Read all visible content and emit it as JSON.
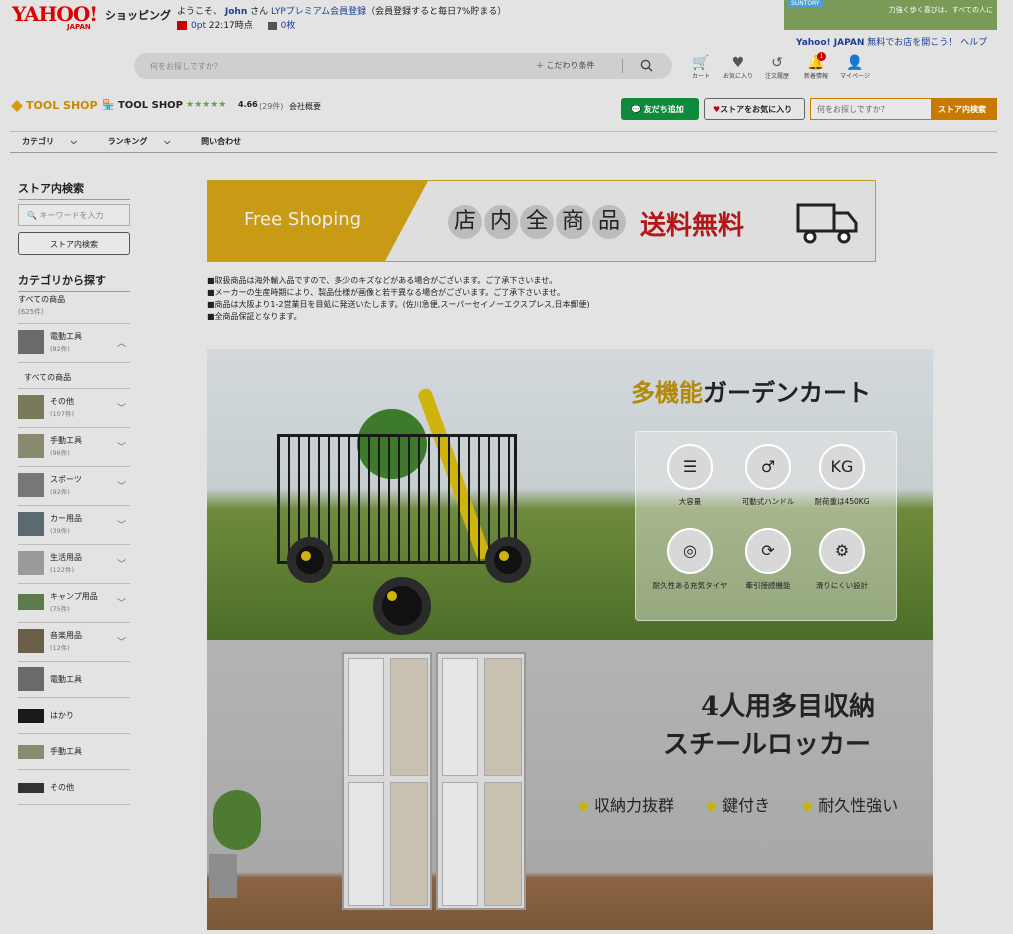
{
  "header": {
    "logo": "YAHOO!",
    "logo_sub": "JAPAN",
    "shopping": "ショッピング",
    "welcome_pre": "ようこそ、",
    "user": "John",
    "welcome_san": "さん",
    "lyp_link": "LYPプレミアム会員登録",
    "lyp_note": "（会員登録すると毎日7%貯まる）",
    "points": "0pt",
    "points_time": "22:17時点",
    "coupons": "0枚",
    "ad_brand": "SUNTORY",
    "ad_text": "力強く歩く喜びは、すべての人に",
    "links": [
      "Yahoo! JAPAN",
      "無料でお店を開こう！",
      "ヘルプ"
    ]
  },
  "search": {
    "placeholder": "何をお探しですか？",
    "conditions": "こだわり条件"
  },
  "icons": [
    {
      "label": "カート",
      "icon": "cart-icon"
    },
    {
      "label": "お気に入り",
      "icon": "heart-icon"
    },
    {
      "label": "注文履歴",
      "icon": "history-icon"
    },
    {
      "label": "新着情報",
      "icon": "bell-icon",
      "badge": "1"
    },
    {
      "label": "マイページ",
      "icon": "user-icon"
    }
  ],
  "store": {
    "logo": "TOOL SHOP",
    "name": "TOOL SHOP",
    "stars": "★★★★★",
    "rating": "4.66",
    "count": "(29件)",
    "about": "会社概要",
    "line_btn": "友だち追加",
    "fav_btn": "ストアをお気に入り",
    "search_placeholder": "何をお探しですか？",
    "search_btn": "ストア内検索"
  },
  "nav": [
    "カテゴリ",
    "ランキング",
    "問い合わせ"
  ],
  "sidebar": {
    "search_title": "ストア内検索",
    "keyword_placeholder": "キーワードを入力",
    "search_btn": "ストア内検索",
    "cat_title": "カテゴリから探す",
    "all": "すべての商品",
    "all_count": "(625件)",
    "categories": [
      {
        "name": "電動工具",
        "count": "(82件)"
      },
      {
        "name": "すべての商品"
      },
      {
        "name": "その他",
        "count": "(107件)"
      },
      {
        "name": "手動工具",
        "count": "(96件)"
      },
      {
        "name": "スポーツ",
        "count": "(92件)"
      },
      {
        "name": "カー用品",
        "count": "(39件)"
      },
      {
        "name": "生活用品",
        "count": "(122件)"
      },
      {
        "name": "キャンプ用品",
        "count": "(75件)"
      },
      {
        "name": "音楽用品",
        "count": "(12件)"
      },
      {
        "name": "電動工具"
      },
      {
        "name": "はかり"
      },
      {
        "name": "手動工具"
      },
      {
        "name": "その他"
      }
    ]
  },
  "banner": {
    "free": "Free Shoping",
    "chars": [
      "店",
      "内",
      "全",
      "商",
      "品"
    ],
    "shipping": "送料無料"
  },
  "notes": [
    "■取扱商品は海外輸入品ですので、多少のキズなどがある場合がございます。ご了承下さいませ。",
    "■メーカーの生産時期により、製品仕様が画像と若干異なる場合がございます。ご了承下さいませ。",
    "■商品は大阪より1-2営業日を目処に発送いたします。(佐川急便,スーパーセイノーエクスプレス,日本郵便)",
    "■全商品保証となります。"
  ],
  "cart_promo": {
    "title_accent": "多機能",
    "title_rest": "ガーデンカート",
    "features": [
      "大容量",
      "可動式ハンドル",
      "耐荷重は450KG",
      "耐久性ある充気タイヤ",
      "牽引接続機能",
      "滑りにくい設計"
    ],
    "kg": "KG"
  },
  "locker_promo": {
    "title1": "4人用多目収納",
    "title2": "スチールロッカー",
    "points": [
      "収納力抜群",
      "鍵付き",
      "耐久性強い"
    ]
  }
}
